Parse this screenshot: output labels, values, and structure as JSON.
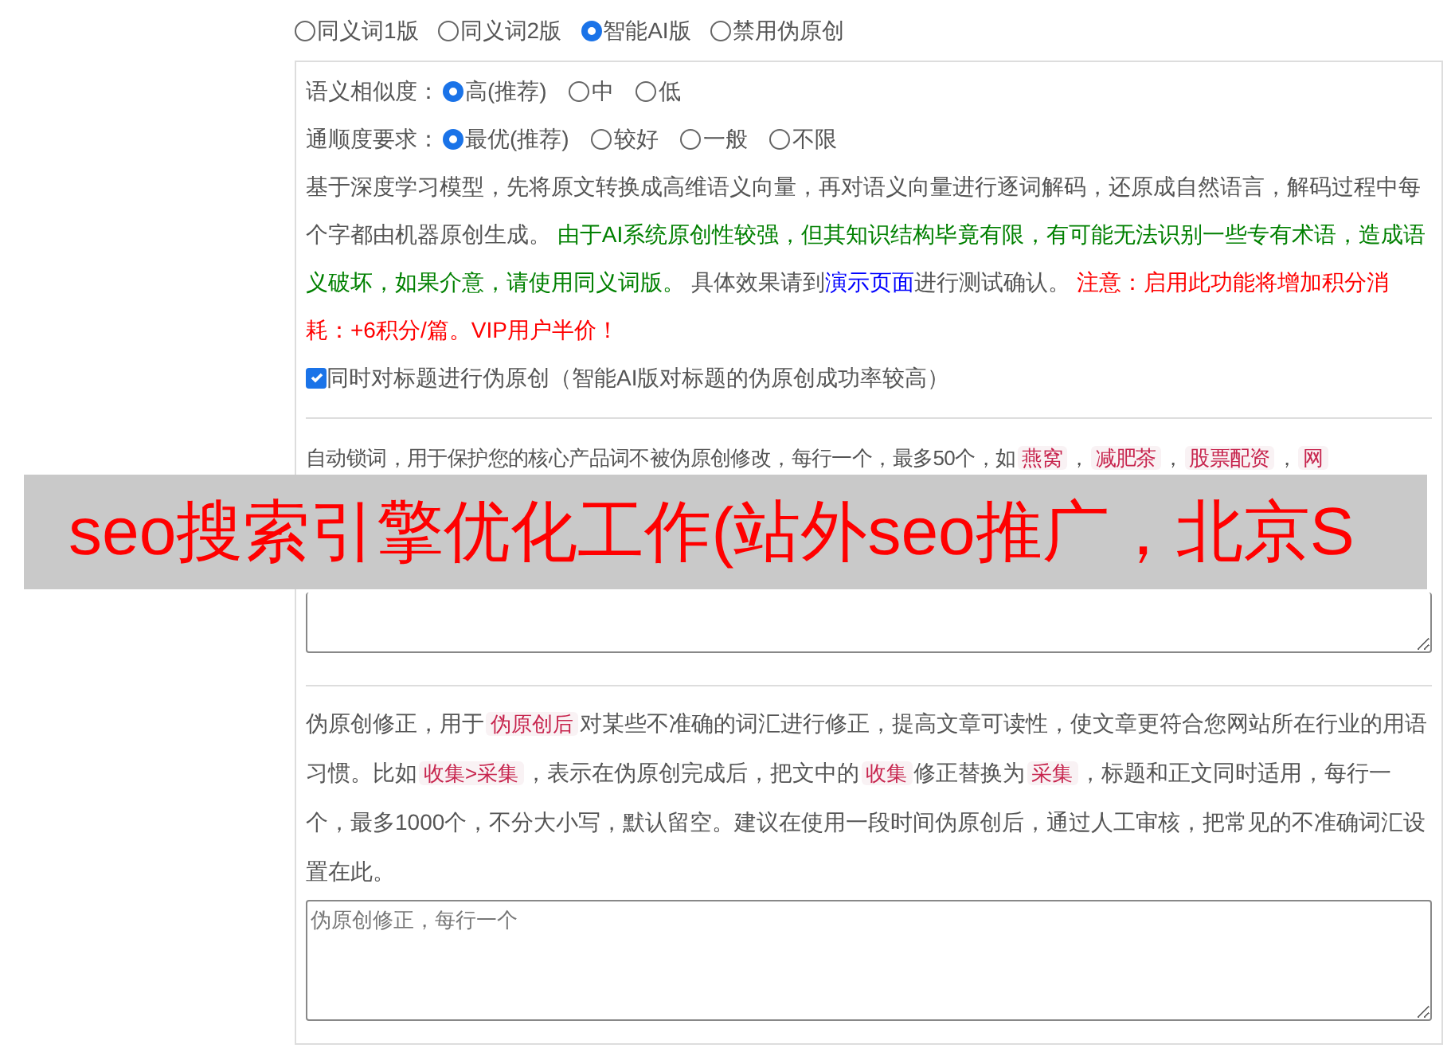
{
  "mode_options": [
    {
      "label": "同义词1版",
      "selected": false
    },
    {
      "label": "同义词2版",
      "selected": false
    },
    {
      "label": "智能AI版",
      "selected": true
    },
    {
      "label": "禁用伪原创",
      "selected": false
    }
  ],
  "similarity": {
    "label": "语义相似度：",
    "options": [
      {
        "label": "高(推荐)",
        "selected": true
      },
      {
        "label": "中",
        "selected": false
      },
      {
        "label": "低",
        "selected": false
      }
    ]
  },
  "fluency": {
    "label": "通顺度要求：",
    "options": [
      {
        "label": "最优(推荐)",
        "selected": true
      },
      {
        "label": "较好",
        "selected": false
      },
      {
        "label": "一般",
        "selected": false
      },
      {
        "label": "不限",
        "selected": false
      }
    ]
  },
  "description": [
    {
      "kind": "text",
      "text": "基于深度学习模型，先将原文转换成高维语义向量，再对语义向量进行逐词解码，还原成自然语言，解码过程中每个字都由机器原创生成。 "
    },
    {
      "kind": "notice",
      "text": "由于AI系统原创性较强，但其知识结构毕竟有限，有可能无法识别一些专有术语，造成语义破坏，如果介意，请使用同义词版。"
    },
    {
      "kind": "text",
      "text": " 具体效果请到"
    },
    {
      "kind": "link",
      "text": "演示页面"
    },
    {
      "kind": "text",
      "text": "进行测试确认。 "
    },
    {
      "kind": "warning",
      "text": "注意：启用此功能将增加积分消耗：+6积分/篇。VIP用户半价！"
    }
  ],
  "title_option": {
    "label": "同时对标题进行伪原创（智能AI版对标题的伪原创成功率较高）",
    "checked": true
  },
  "lock_words": {
    "hint": [
      {
        "kind": "text",
        "text": "自动锁词，用于保护您的核心产品词不被伪原创修改，每行一个，最多50个，如"
      },
      {
        "kind": "tag",
        "text": "燕窝"
      },
      {
        "kind": "text",
        "text": "，"
      },
      {
        "kind": "tag",
        "text": "减肥茶"
      },
      {
        "kind": "text",
        "text": "，"
      },
      {
        "kind": "tag",
        "text": "股票配资"
      },
      {
        "kind": "text",
        "text": "，"
      },
      {
        "kind": "tag",
        "text": "网"
      }
    ]
  },
  "correction": {
    "hint": [
      {
        "kind": "text",
        "text": "伪原创修正，用于"
      },
      {
        "kind": "tag",
        "text": "伪原创后"
      },
      {
        "kind": "text",
        "text": "对某些不准确的词汇进行修正，提高文章可读性，使文章更符合您网站所在行业的用语习惯。比如"
      },
      {
        "kind": "tag",
        "text": "收集>采集"
      },
      {
        "kind": "text",
        "text": "，表示在伪原创完成后，把文中的"
      },
      {
        "kind": "tag",
        "text": "收集"
      },
      {
        "kind": "text",
        "text": "修正替换为"
      },
      {
        "kind": "tag",
        "text": "采集"
      },
      {
        "kind": "text",
        "text": "，标题和正文同时适用，每行一个，最多1000个，不分大小写，默认留空。建议在使用一段时间伪原创后，通过人工审核，把常见的不准确词汇设置在此。"
      }
    ],
    "field": {
      "placeholder": "伪原创修正，每行一个"
    }
  },
  "banner": {
    "text": "seo搜索引擎优化工作(站外seo推广，北京S"
  }
}
